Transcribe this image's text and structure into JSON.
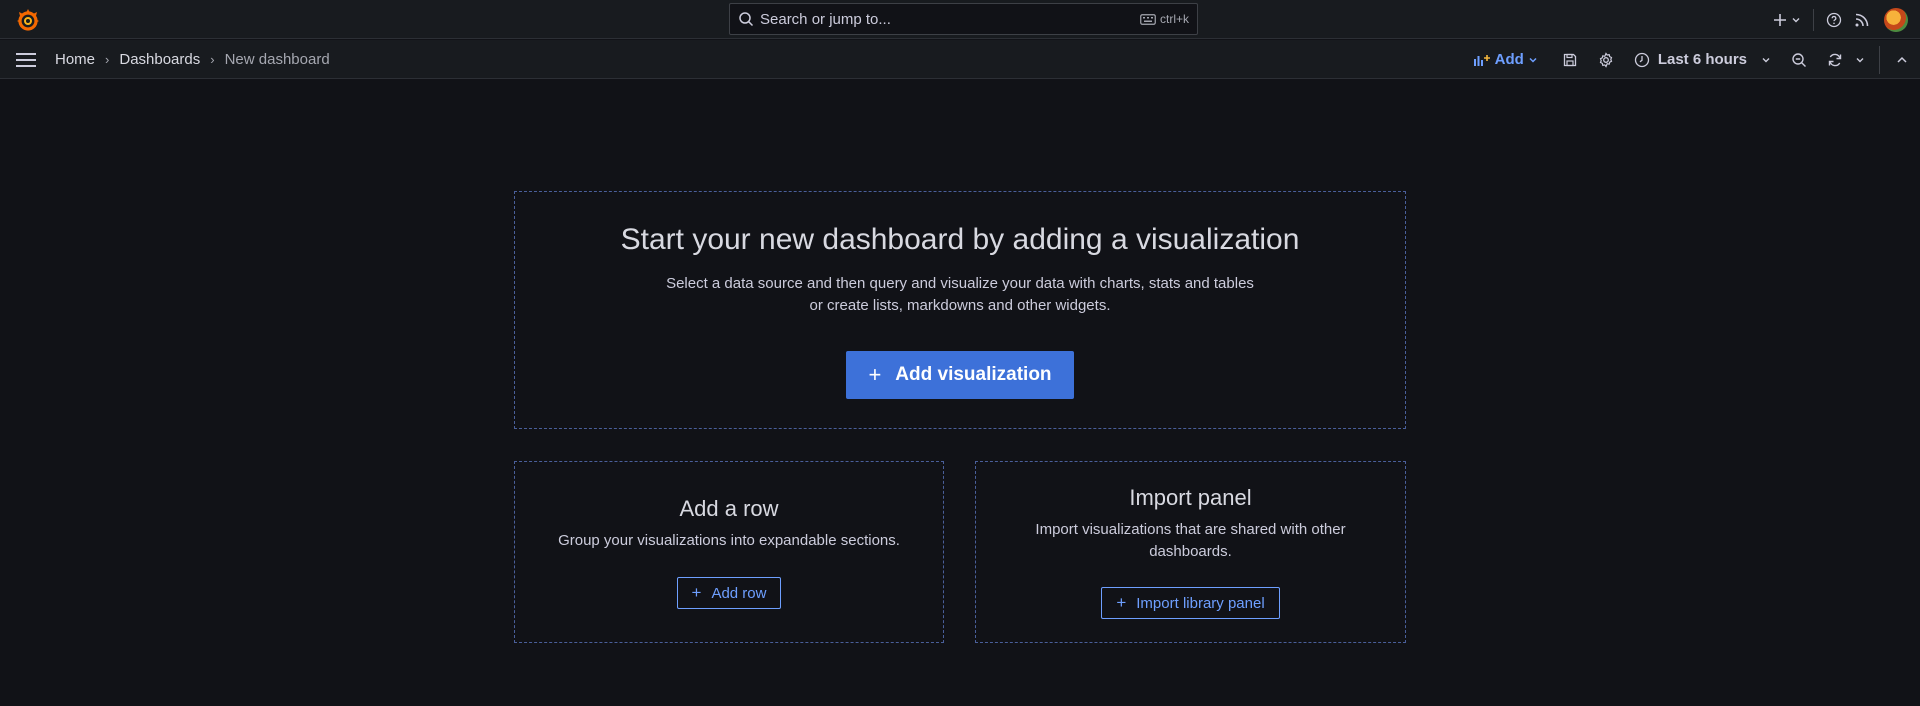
{
  "topbar": {
    "search_placeholder": "Search or jump to...",
    "shortcut": "ctrl+k"
  },
  "breadcrumb": {
    "items": [
      "Home",
      "Dashboards",
      "New dashboard"
    ]
  },
  "toolbar": {
    "add_label": "Add",
    "time_range": "Last 6 hours"
  },
  "main_panel": {
    "title": "Start your new dashboard by adding a visualization",
    "desc_line1": "Select a data source and then query and visualize your data with charts, stats and tables",
    "desc_line2": "or create lists, markdowns and other widgets.",
    "button": "Add visualization"
  },
  "row_panel": {
    "title": "Add a row",
    "desc": "Group your visualizations into expandable sections.",
    "button": "Add row"
  },
  "import_panel": {
    "title": "Import panel",
    "desc": "Import visualizations that are shared with other dashboards.",
    "button": "Import library panel"
  },
  "colors": {
    "background": "#111217",
    "bar": "#181b1f",
    "primary": "#3d71d9",
    "link": "#6e9fff",
    "dashed_border": "#4a5f9a"
  }
}
